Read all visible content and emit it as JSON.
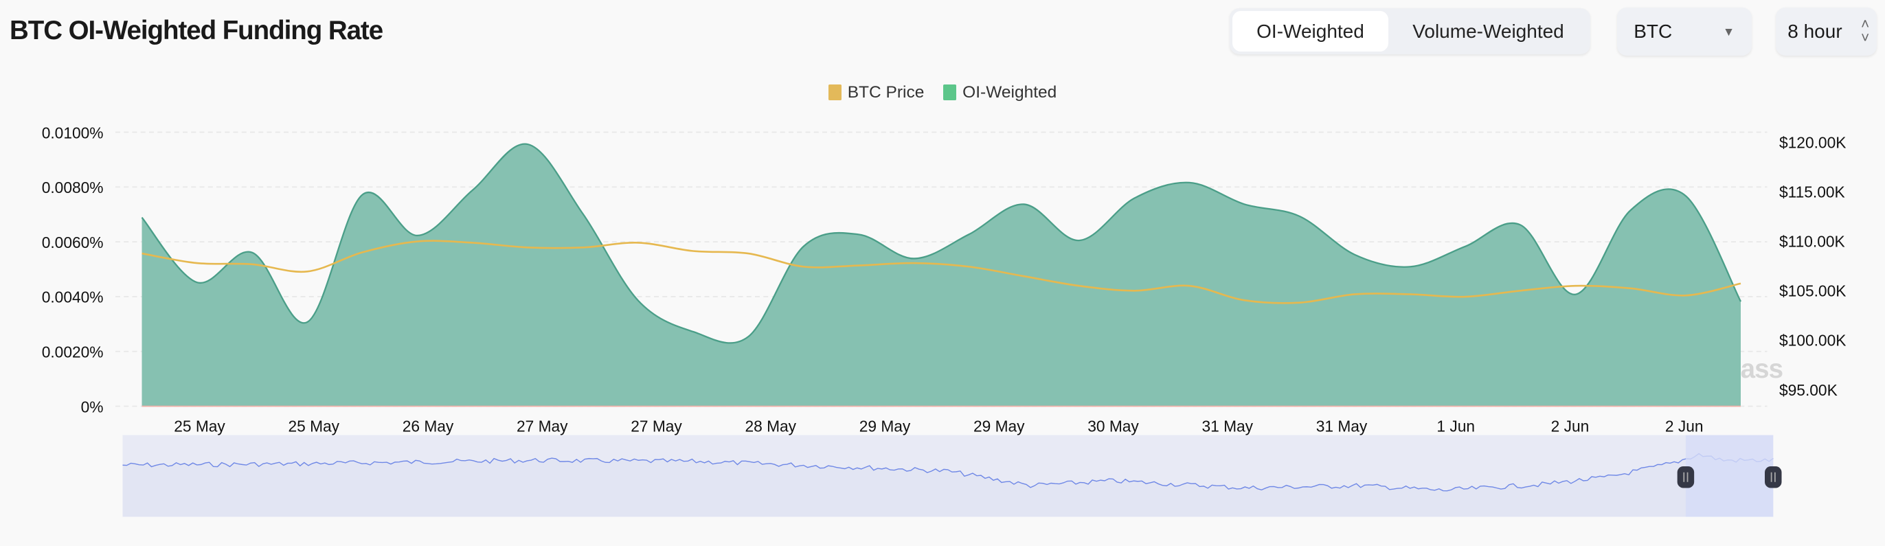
{
  "header": {
    "title": "BTC OI-Weighted Funding Rate"
  },
  "toggle": {
    "options": [
      "OI-Weighted",
      "Volume-Weighted"
    ],
    "active": "OI-Weighted"
  },
  "coin_select": {
    "value": "BTC",
    "icon": "caret-down-icon"
  },
  "interval_select": {
    "value": "8 hour",
    "icon": "up-down-chevron-icon"
  },
  "watermark": "coinglass",
  "colors": {
    "price": "#e6b84f",
    "funding_fill": "#86c1b1",
    "funding_line": "#4a9e88",
    "navigator_line": "#6f88e6",
    "navigator_bg": "#e8eaf5",
    "navigator_window": "#d6dcf7"
  },
  "chart_data": {
    "type": "area",
    "legend": [
      "BTC Price",
      "OI-Weighted"
    ],
    "legend_position": "top-center",
    "grid": true,
    "x_tick_labels": [
      "25 May",
      "25 May",
      "26 May",
      "27 May",
      "27 May",
      "28 May",
      "29 May",
      "29 May",
      "30 May",
      "31 May",
      "31 May",
      "1 Jun",
      "2 Jun",
      "2 Jun"
    ],
    "y_left": {
      "ticks": [
        "0.0100%",
        "0.0080%",
        "0.0060%",
        "0.0040%",
        "0.0020%",
        "0%"
      ],
      "tick_values": [
        0.01,
        0.008,
        0.006,
        0.004,
        0.002,
        0
      ],
      "range": [
        0,
        0.01
      ]
    },
    "y_right": {
      "ticks": [
        "$120.00K",
        "$115.00K",
        "$110.00K",
        "$105.00K",
        "$100.00K",
        "$95.00K"
      ],
      "tick_values": [
        120000,
        115000,
        110000,
        105000,
        100000,
        95000
      ],
      "range": [
        93300,
        121000
      ]
    },
    "series": [
      {
        "name": "OI-Weighted",
        "type": "area",
        "unit": "%",
        "values": [
          0.00689,
          0.00452,
          0.00561,
          0.00307,
          0.00772,
          0.00623,
          0.00789,
          0.00956,
          0.00702,
          0.00386,
          0.00272,
          0.00254,
          0.00583,
          0.00627,
          0.00539,
          0.00627,
          0.00737,
          0.00605,
          0.00759,
          0.00816,
          0.00737,
          0.00693,
          0.00553,
          0.00509,
          0.00583,
          0.00662,
          0.00408,
          0.00715,
          0.00768,
          0.00382
        ]
      },
      {
        "name": "BTC Price",
        "type": "line",
        "unit": "USD",
        "values": [
          108740,
          107770,
          107650,
          106920,
          108860,
          109960,
          109830,
          109350,
          109350,
          109830,
          108990,
          108740,
          107410,
          107530,
          107770,
          107410,
          106440,
          105470,
          104980,
          105470,
          104010,
          103770,
          104620,
          104620,
          104370,
          104980,
          105470,
          105220,
          104500,
          105710
        ]
      }
    ],
    "navigator": {
      "selected_range_fraction": [
        0.947,
        1.0
      ]
    }
  }
}
